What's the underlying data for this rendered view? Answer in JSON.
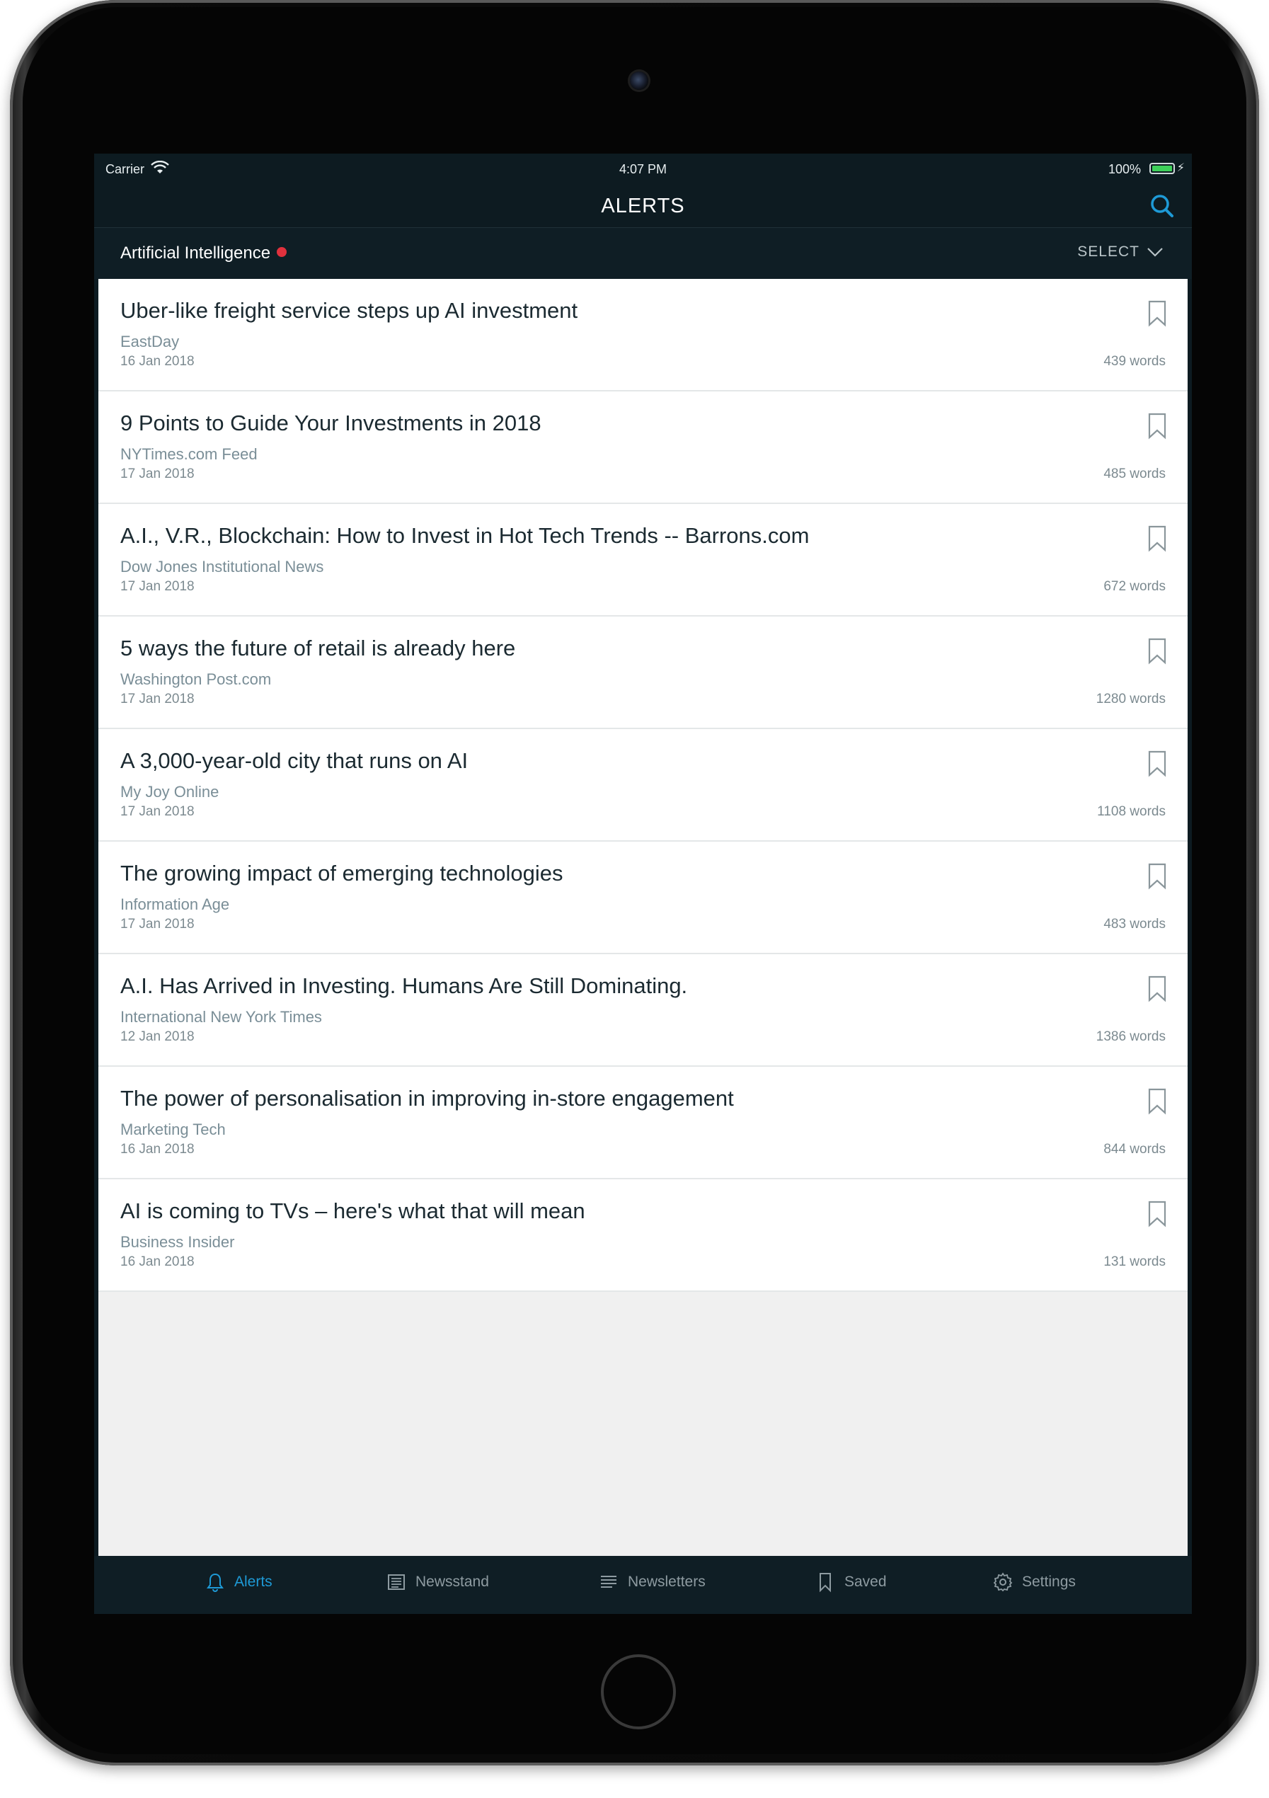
{
  "status_bar": {
    "carrier": "Carrier",
    "time": "4:07 PM",
    "battery": "100%"
  },
  "nav": {
    "title": "ALERTS"
  },
  "filter": {
    "topic": "Artificial Intelligence",
    "select_label": "SELECT"
  },
  "articles": [
    {
      "title": "Uber-like freight service steps up AI investment",
      "source": "EastDay",
      "date": "16 Jan 2018",
      "words": "439 words"
    },
    {
      "title": "9 Points to Guide Your Investments in 2018",
      "source": "NYTimes.com Feed",
      "date": "17 Jan 2018",
      "words": "485 words"
    },
    {
      "title": "A.I., V.R., Blockchain: How to Invest in Hot Tech Trends -- Barrons.com",
      "source": "Dow Jones Institutional News",
      "date": "17 Jan 2018",
      "words": "672 words"
    },
    {
      "title": "5 ways the future of retail is already here",
      "source": "Washington Post.com",
      "date": "17 Jan 2018",
      "words": "1280 words"
    },
    {
      "title": "A 3,000-year-old city that runs on AI",
      "source": "My Joy Online",
      "date": "17 Jan 2018",
      "words": "1108 words"
    },
    {
      "title": "The growing impact of emerging technologies",
      "source": "Information Age",
      "date": "17 Jan 2018",
      "words": "483 words"
    },
    {
      "title": "A.I. Has Arrived in Investing. Humans Are Still Dominating.",
      "source": "International New York Times",
      "date": "12 Jan 2018",
      "words": "1386 words"
    },
    {
      "title": "The power of personalisation in improving in-store engagement",
      "source": "Marketing Tech",
      "date": "16 Jan 2018",
      "words": "844 words"
    },
    {
      "title": "AI is coming to TVs – here's what that will mean",
      "source": "Business Insider",
      "date": "16 Jan 2018",
      "words": "131 words"
    }
  ],
  "tabs": [
    {
      "label": "Alerts",
      "icon": "bell-icon",
      "active": true
    },
    {
      "label": "Newsstand",
      "icon": "newspaper-icon",
      "active": false
    },
    {
      "label": "Newsletters",
      "icon": "lines-icon",
      "active": false
    },
    {
      "label": "Saved",
      "icon": "bookmark-icon",
      "active": false
    },
    {
      "label": "Settings",
      "icon": "gear-icon",
      "active": false
    }
  ],
  "colors": {
    "accent": "#1e9ad6",
    "header_bg": "#0d1b21",
    "unread_dot": "#e0313d",
    "empty_area": "#f0f0f0"
  }
}
